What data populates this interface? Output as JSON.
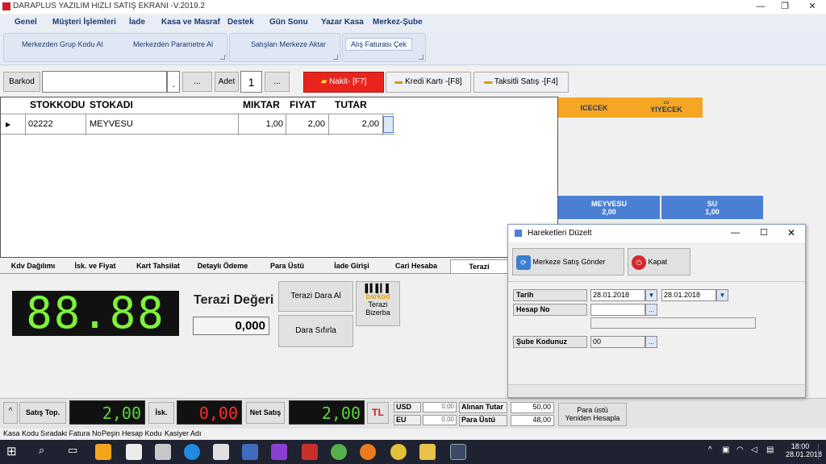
{
  "window": {
    "title": "DARAPLUS YAZILIM HIZLI SATIŞ EKRANI -V.2019.2"
  },
  "menu": [
    "Genel",
    "Müşteri İşlemleri",
    "İade",
    "Kasa ve Masraf",
    "Destek",
    "Gün Sonu",
    "Yazar Kasa",
    "Merkez-Şube"
  ],
  "ribbon": {
    "btn1": "Merkezden Grup Kodu Al",
    "btn2": "Merkezden Parametre Al",
    "btn3": "Satışları Merkeze Aktar",
    "btn4": "Alış Faturası Çek"
  },
  "toolbar": {
    "barkod_label": "Barkod",
    "dot": ".",
    "dots": "...",
    "adet_label": "Adet",
    "adet_value": "1",
    "nakit": "Nakit- [F7]",
    "kredi": "Kredi Kartı -[F8]",
    "taksitli": "Taksitli Satış -[F4]"
  },
  "grid": {
    "headers": [
      "STOKKODU",
      "STOKADI",
      "MIKTAR",
      "FIYAT",
      "TUTAR"
    ],
    "rows": [
      [
        "02222",
        "MEYVESU",
        "1,00",
        "2,00",
        "2,00"
      ]
    ]
  },
  "tiles": {
    "icecek": "ICECEK",
    "yiyecek": "YIYECEK",
    "p1_name": "MEYVESU",
    "p1_price": "2,00",
    "p2_name": "SU",
    "p2_price": "1,00"
  },
  "tabs": [
    "Kdv Dağılımı",
    "İsk. ve Fiyat",
    "Kart Tahsilat",
    "Detaylı Ödeme",
    "Para Üstü",
    "İade Girişi",
    "Cari Hesaba",
    "Terazi"
  ],
  "terazi": {
    "display": "88.88",
    "title": "Terazi Değeri",
    "value": "0,000",
    "dara_al": "Terazi Dara Al",
    "dara_sifirla": "Dara Sıfırla",
    "bizerba_1": "barkod",
    "bizerba_2": "Terazi",
    "bizerba_3": "Bizerba"
  },
  "bottom": {
    "caret": "^",
    "satis_top_label": "Satış Top.",
    "satis_top": "2,00",
    "isk_label": "İsk.",
    "isk": "0,00",
    "net_label": "Net Satış",
    "net": "2,00",
    "currency": "TL",
    "usd": "USD",
    "usd_val": "0,00",
    "eu": "EU",
    "eu_val": "0,00",
    "alinan_label": "Alınan Tutar",
    "alinan": "50,00",
    "para_ustu_label": "Para Üstü",
    "para_ustu": "48,00",
    "recalc_1": "Para üstü",
    "recalc_2": "Yeniden Hesapla"
  },
  "status": [
    "Kasa Kodu",
    "Sıradaki Fatura No",
    "Peşin Hesap Kodu",
    "Kasiyer Adı"
  ],
  "dialog": {
    "title": "Hareketleri Düzelt",
    "send": "Merkeze Satış Gönder",
    "close": "Kapat",
    "tarih_label": "Tarih",
    "tarih1": "28.01.2018",
    "tarih2": "28.01.2018",
    "hesap_label": "Hesap No",
    "hesap_value": "",
    "dots": "...",
    "sube_label": "Şube Kodunuz",
    "sube_value": "00"
  },
  "taskbar": {
    "time": "18:00",
    "date": "28.01.2018"
  },
  "colors": {
    "nakit": "#e8241f",
    "lcd_green": "#7df23a",
    "lcd_red": "#ff2d2d",
    "tile_orange": "#f5a623",
    "tile_blue": "#4a7fd4"
  }
}
